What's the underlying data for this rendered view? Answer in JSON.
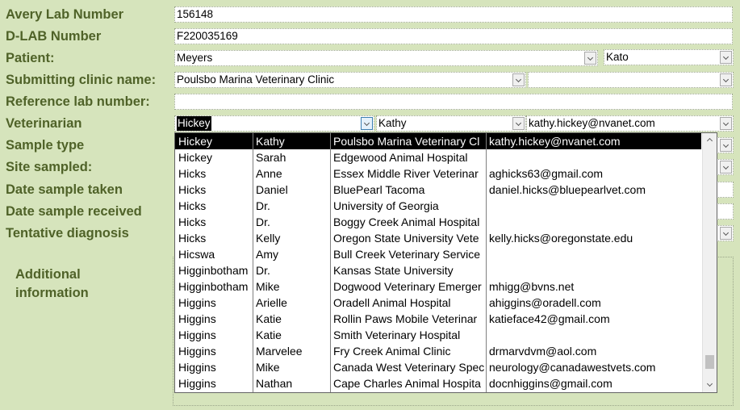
{
  "labels": {
    "avery_lab_number": "Avery Lab Number",
    "dlab_number": "D-LAB Number",
    "patient": "Patient:",
    "submitting_clinic": "Submitting clinic name:",
    "reference_lab": "Reference lab number:",
    "veterinarian": "Veterinarian",
    "sample_type": "Sample type",
    "site_sampled": "Site sampled:",
    "date_sample_taken": "Date sample taken",
    "date_sample_received": "Date sample received",
    "tentative_diagnosis": "Tentative diagnosis",
    "additional_information": "Additional information"
  },
  "values": {
    "avery_lab_number": "156148",
    "dlab_number": "F220035169",
    "patient_last": "Meyers",
    "patient_first": "Kato",
    "clinic": "Poulsbo Marina Veterinary Clinic",
    "clinic_extra": "",
    "reference_lab": "",
    "vet_last": "Hickey",
    "vet_first": "Kathy",
    "vet_email": "kathy.hickey@nvanet.com"
  },
  "veterinarian_list": [
    {
      "last": "Hickey",
      "first": "Kathy",
      "clinic": "Poulsbo Marina Veterinary Cl",
      "email": "kathy.hickey@nvanet.com",
      "selected": true
    },
    {
      "last": "Hickey",
      "first": "Sarah",
      "clinic": "Edgewood Animal Hospital",
      "email": ""
    },
    {
      "last": "Hicks",
      "first": "Anne",
      "clinic": "Essex Middle River Veterinar",
      "email": "aghicks63@gmail.com"
    },
    {
      "last": "Hicks",
      "first": "Daniel",
      "clinic": "BluePearl Tacoma",
      "email": "daniel.hicks@bluepearlvet.com"
    },
    {
      "last": "Hicks",
      "first": "Dr.",
      "clinic": "University of Georgia",
      "email": ""
    },
    {
      "last": "Hicks",
      "first": "Dr.",
      "clinic": "Boggy Creek Animal Hospital",
      "email": ""
    },
    {
      "last": "Hicks",
      "first": "Kelly",
      "clinic": "Oregon State University Vete",
      "email": "kelly.hicks@oregonstate.edu"
    },
    {
      "last": "Hicswa",
      "first": "Amy",
      "clinic": "Bull Creek Veterinary Service",
      "email": ""
    },
    {
      "last": "Higginbotham",
      "first": "Dr.",
      "clinic": "Kansas State University",
      "email": ""
    },
    {
      "last": "Higginbotham",
      "first": "Mike",
      "clinic": "Dogwood Veterinary Emerger",
      "email": "mhigg@bvns.net"
    },
    {
      "last": "Higgins",
      "first": "Arielle",
      "clinic": "Oradell Animal Hospital",
      "email": "ahiggins@oradell.com"
    },
    {
      "last": "Higgins",
      "first": "Katie",
      "clinic": "Rollin Paws Mobile Veterinar",
      "email": "katieface42@gmail.com"
    },
    {
      "last": "Higgins",
      "first": "Katie",
      "clinic": "Smith Veterinary Hospital",
      "email": ""
    },
    {
      "last": "Higgins",
      "first": "Marvelee",
      "clinic": "Fry Creek Animal Clinic",
      "email": "drmarvdvm@aol.com"
    },
    {
      "last": "Higgins",
      "first": "Mike",
      "clinic": "Canada West Veterinary Spec",
      "email": "neurology@canadawestvets.com"
    },
    {
      "last": "Higgins",
      "first": "Nathan",
      "clinic": "Cape Charles Animal Hospita",
      "email": "docnhiggins@gmail.com"
    }
  ],
  "icons": {
    "dropdown": "chevron-down-icon",
    "scroll_up": "scroll-up-arrow-icon",
    "scroll_down": "scroll-down-arrow-icon"
  },
  "colors": {
    "background": "#d6e4bc",
    "label": "#4f6228",
    "selection": "#000000"
  }
}
